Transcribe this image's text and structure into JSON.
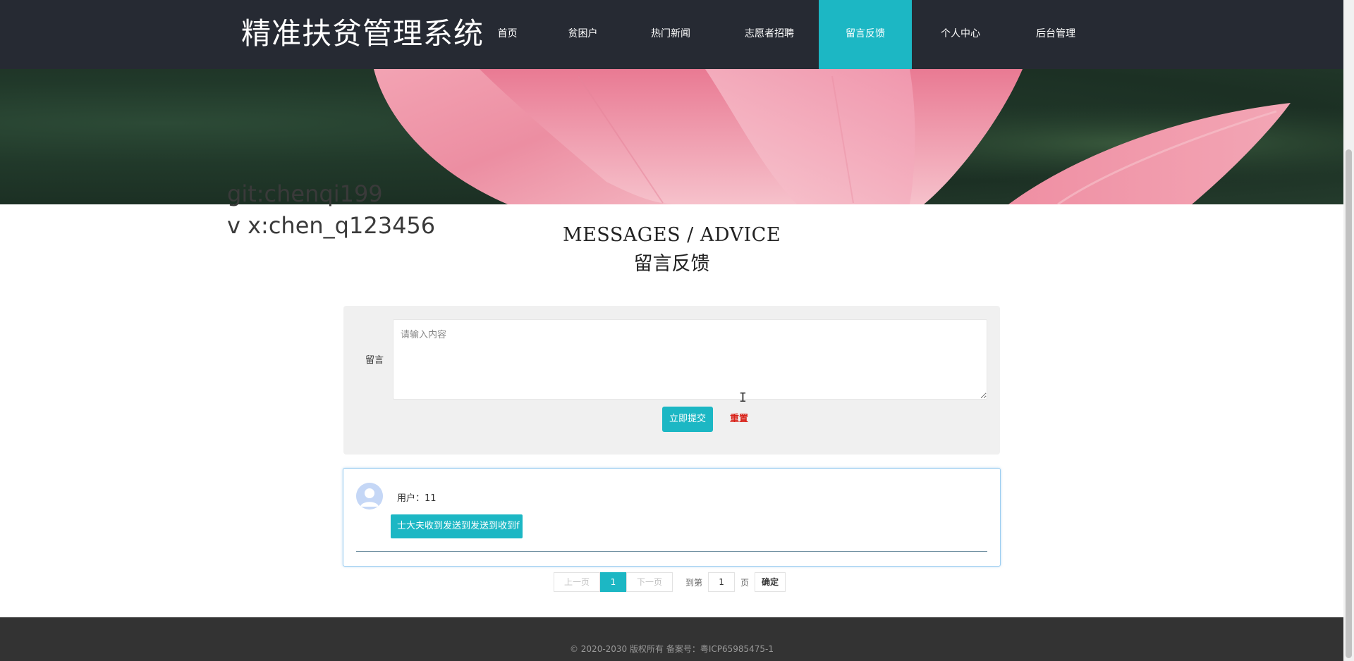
{
  "header": {
    "logo": "精准扶贫管理系统",
    "nav": [
      {
        "label": "首页",
        "active": false
      },
      {
        "label": "贫困户",
        "active": false
      },
      {
        "label": "热门新闻",
        "active": false
      },
      {
        "label": "志愿者招聘",
        "active": false
      },
      {
        "label": "留言反馈",
        "active": true
      },
      {
        "label": "个人中心",
        "active": false
      },
      {
        "label": "后台管理",
        "active": false
      }
    ]
  },
  "contact": {
    "line1": "git:chenqi199",
    "line2": "v x:chen_q123456"
  },
  "section": {
    "title_en": "MESSAGES / ADVICE",
    "title_cn": "留言反馈"
  },
  "form": {
    "label": "留言",
    "placeholder": "请输入内容",
    "submit_label": "立即提交",
    "reset_label": "重置"
  },
  "messages": [
    {
      "user": "用户：11",
      "content": "士大夫收到发送到发送到收到f"
    }
  ],
  "pagination": {
    "prev_label": "上一页",
    "current": "1",
    "next_label": "下一页",
    "goto_prefix": "到第",
    "goto_value": "1",
    "goto_suffix": "页",
    "confirm_label": "确定"
  },
  "footer": {
    "text": "© 2020-2030 版权所有 备案号：粤ICP65985475-1"
  },
  "colors": {
    "header_bg": "#262a33",
    "accent": "#1cb7c4",
    "reset_red": "#d9231a",
    "footer_bg": "#333333"
  }
}
